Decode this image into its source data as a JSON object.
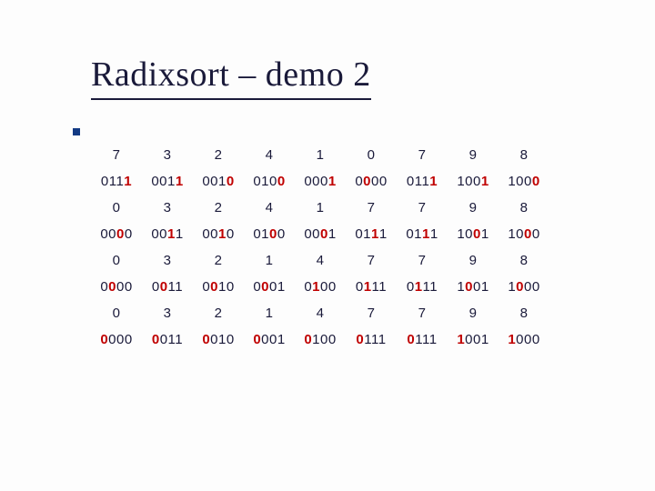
{
  "title": "Radixsort – demo 2",
  "rows": [
    {
      "kind": "dec",
      "cells": [
        {
          "t": "7",
          "cls": "b"
        },
        {
          "t": "3"
        },
        {
          "t": "2"
        },
        {
          "t": "4"
        },
        {
          "t": "1"
        },
        {
          "t": "0"
        },
        {
          "t": "7",
          "cls": "b"
        },
        {
          "t": "9"
        },
        {
          "t": "8"
        }
      ]
    },
    {
      "kind": "bin",
      "cells": [
        {
          "bits": [
            {
              "t": "0"
            },
            {
              "t": "1"
            },
            {
              "t": "1"
            },
            {
              "t": "1",
              "cls": "hl"
            }
          ]
        },
        {
          "bits": [
            {
              "t": "0"
            },
            {
              "t": "0"
            },
            {
              "t": "1"
            },
            {
              "t": "1",
              "cls": "hl"
            }
          ]
        },
        {
          "bits": [
            {
              "t": "0"
            },
            {
              "t": "0"
            },
            {
              "t": "1"
            },
            {
              "t": "0",
              "cls": "hl"
            }
          ]
        },
        {
          "bits": [
            {
              "t": "0"
            },
            {
              "t": "1"
            },
            {
              "t": "0"
            },
            {
              "t": "0",
              "cls": "hl"
            }
          ]
        },
        {
          "bits": [
            {
              "t": "0"
            },
            {
              "t": "0"
            },
            {
              "t": "0"
            },
            {
              "t": "1",
              "cls": "hl"
            }
          ]
        },
        {
          "bits": [
            {
              "t": "0"
            },
            {
              "t": "0",
              "cls": "hl"
            },
            {
              "t": "0"
            },
            {
              "t": "0"
            }
          ]
        },
        {
          "bits": [
            {
              "t": "0"
            },
            {
              "t": "1"
            },
            {
              "t": "1"
            },
            {
              "t": "1",
              "cls": "hl"
            }
          ]
        },
        {
          "bits": [
            {
              "t": "1"
            },
            {
              "t": "0"
            },
            {
              "t": "0"
            },
            {
              "t": "1",
              "cls": "hl"
            }
          ]
        },
        {
          "bits": [
            {
              "t": "1"
            },
            {
              "t": "0"
            },
            {
              "t": "0"
            },
            {
              "t": "0",
              "cls": "hl"
            }
          ]
        }
      ]
    },
    {
      "kind": "dec",
      "cells": [
        {
          "t": "0",
          "cls": "b"
        },
        {
          "t": "3"
        },
        {
          "t": "2"
        },
        {
          "t": "4"
        },
        {
          "t": "1"
        },
        {
          "t": "7"
        },
        {
          "t": "7",
          "cls": "b"
        },
        {
          "t": "9"
        },
        {
          "t": "8"
        }
      ]
    },
    {
      "kind": "bin",
      "cells": [
        {
          "bits": [
            {
              "t": "0"
            },
            {
              "t": "0"
            },
            {
              "t": "0",
              "cls": "hl"
            },
            {
              "t": "0"
            }
          ]
        },
        {
          "bits": [
            {
              "t": "0"
            },
            {
              "t": "0"
            },
            {
              "t": "1",
              "cls": "hl"
            },
            {
              "t": "1"
            }
          ]
        },
        {
          "bits": [
            {
              "t": "0"
            },
            {
              "t": "0"
            },
            {
              "t": "1",
              "cls": "hl"
            },
            {
              "t": "0"
            }
          ]
        },
        {
          "bits": [
            {
              "t": "0"
            },
            {
              "t": "1"
            },
            {
              "t": "0",
              "cls": "hl"
            },
            {
              "t": "0"
            }
          ]
        },
        {
          "bits": [
            {
              "t": "0"
            },
            {
              "t": "0"
            },
            {
              "t": "0",
              "cls": "hl"
            },
            {
              "t": "1"
            }
          ]
        },
        {
          "bits": [
            {
              "t": "0"
            },
            {
              "t": "1"
            },
            {
              "t": "1",
              "cls": "hl"
            },
            {
              "t": "1"
            }
          ]
        },
        {
          "bits": [
            {
              "t": "0"
            },
            {
              "t": "1"
            },
            {
              "t": "1",
              "cls": "hl"
            },
            {
              "t": "1"
            }
          ]
        },
        {
          "bits": [
            {
              "t": "1"
            },
            {
              "t": "0"
            },
            {
              "t": "0",
              "cls": "hl"
            },
            {
              "t": "1"
            }
          ]
        },
        {
          "bits": [
            {
              "t": "1"
            },
            {
              "t": "0"
            },
            {
              "t": "0",
              "cls": "hl"
            },
            {
              "t": "0"
            }
          ]
        }
      ]
    },
    {
      "kind": "dec",
      "cells": [
        {
          "t": "0",
          "cls": "b"
        },
        {
          "t": "3"
        },
        {
          "t": "2"
        },
        {
          "t": "1"
        },
        {
          "t": "4"
        },
        {
          "t": "7"
        },
        {
          "t": "7",
          "cls": "b"
        },
        {
          "t": "9"
        },
        {
          "t": "8"
        }
      ]
    },
    {
      "kind": "bin",
      "cells": [
        {
          "bits": [
            {
              "t": "0"
            },
            {
              "t": "0",
              "cls": "hl"
            },
            {
              "t": "0"
            },
            {
              "t": "0"
            }
          ]
        },
        {
          "bits": [
            {
              "t": "0"
            },
            {
              "t": "0",
              "cls": "hl"
            },
            {
              "t": "1"
            },
            {
              "t": "1"
            }
          ]
        },
        {
          "bits": [
            {
              "t": "0"
            },
            {
              "t": "0",
              "cls": "hl"
            },
            {
              "t": "1"
            },
            {
              "t": "0"
            }
          ]
        },
        {
          "bits": [
            {
              "t": "0"
            },
            {
              "t": "0",
              "cls": "hl"
            },
            {
              "t": "0"
            },
            {
              "t": "1"
            }
          ]
        },
        {
          "bits": [
            {
              "t": "0"
            },
            {
              "t": "1",
              "cls": "hl"
            },
            {
              "t": "0"
            },
            {
              "t": "0"
            }
          ]
        },
        {
          "bits": [
            {
              "t": "0"
            },
            {
              "t": "1",
              "cls": "hl"
            },
            {
              "t": "1"
            },
            {
              "t": "1"
            }
          ]
        },
        {
          "bits": [
            {
              "t": "0"
            },
            {
              "t": "1",
              "cls": "hl"
            },
            {
              "t": "1"
            },
            {
              "t": "1"
            }
          ]
        },
        {
          "bits": [
            {
              "t": "1"
            },
            {
              "t": "0",
              "cls": "hl"
            },
            {
              "t": "0"
            },
            {
              "t": "1"
            }
          ]
        },
        {
          "bits": [
            {
              "t": "1"
            },
            {
              "t": "0",
              "cls": "hl"
            },
            {
              "t": "0"
            },
            {
              "t": "0"
            }
          ]
        }
      ]
    },
    {
      "kind": "dec",
      "cells": [
        {
          "t": "0",
          "cls": "b"
        },
        {
          "t": "3"
        },
        {
          "t": "2"
        },
        {
          "t": "1"
        },
        {
          "t": "4"
        },
        {
          "t": "7"
        },
        {
          "t": "7",
          "cls": "b"
        },
        {
          "t": "9",
          "cls": "b"
        },
        {
          "t": "8",
          "cls": "b"
        }
      ]
    },
    {
      "kind": "bin",
      "cells": [
        {
          "bits": [
            {
              "t": "0",
              "cls": "hl"
            },
            {
              "t": "0"
            },
            {
              "t": "0"
            },
            {
              "t": "0"
            }
          ]
        },
        {
          "bits": [
            {
              "t": "0",
              "cls": "hl"
            },
            {
              "t": "0"
            },
            {
              "t": "1"
            },
            {
              "t": "1"
            }
          ]
        },
        {
          "bits": [
            {
              "t": "0",
              "cls": "hl"
            },
            {
              "t": "0"
            },
            {
              "t": "1"
            },
            {
              "t": "0"
            }
          ]
        },
        {
          "bits": [
            {
              "t": "0",
              "cls": "hl"
            },
            {
              "t": "0"
            },
            {
              "t": "0"
            },
            {
              "t": "1"
            }
          ]
        },
        {
          "bits": [
            {
              "t": "0",
              "cls": "hl"
            },
            {
              "t": "1"
            },
            {
              "t": "0"
            },
            {
              "t": "0"
            }
          ]
        },
        {
          "bits": [
            {
              "t": "0",
              "cls": "hl"
            },
            {
              "t": "1"
            },
            {
              "t": "1"
            },
            {
              "t": "1"
            }
          ]
        },
        {
          "bits": [
            {
              "t": "0",
              "cls": "hl"
            },
            {
              "t": "1"
            },
            {
              "t": "1"
            },
            {
              "t": "1"
            }
          ]
        },
        {
          "bits": [
            {
              "t": "1",
              "cls": "hl"
            },
            {
              "t": "0"
            },
            {
              "t": "0"
            },
            {
              "t": "1"
            }
          ]
        },
        {
          "bits": [
            {
              "t": "1",
              "cls": "hl"
            },
            {
              "t": "0"
            },
            {
              "t": "0"
            },
            {
              "t": "0"
            }
          ]
        }
      ]
    }
  ]
}
